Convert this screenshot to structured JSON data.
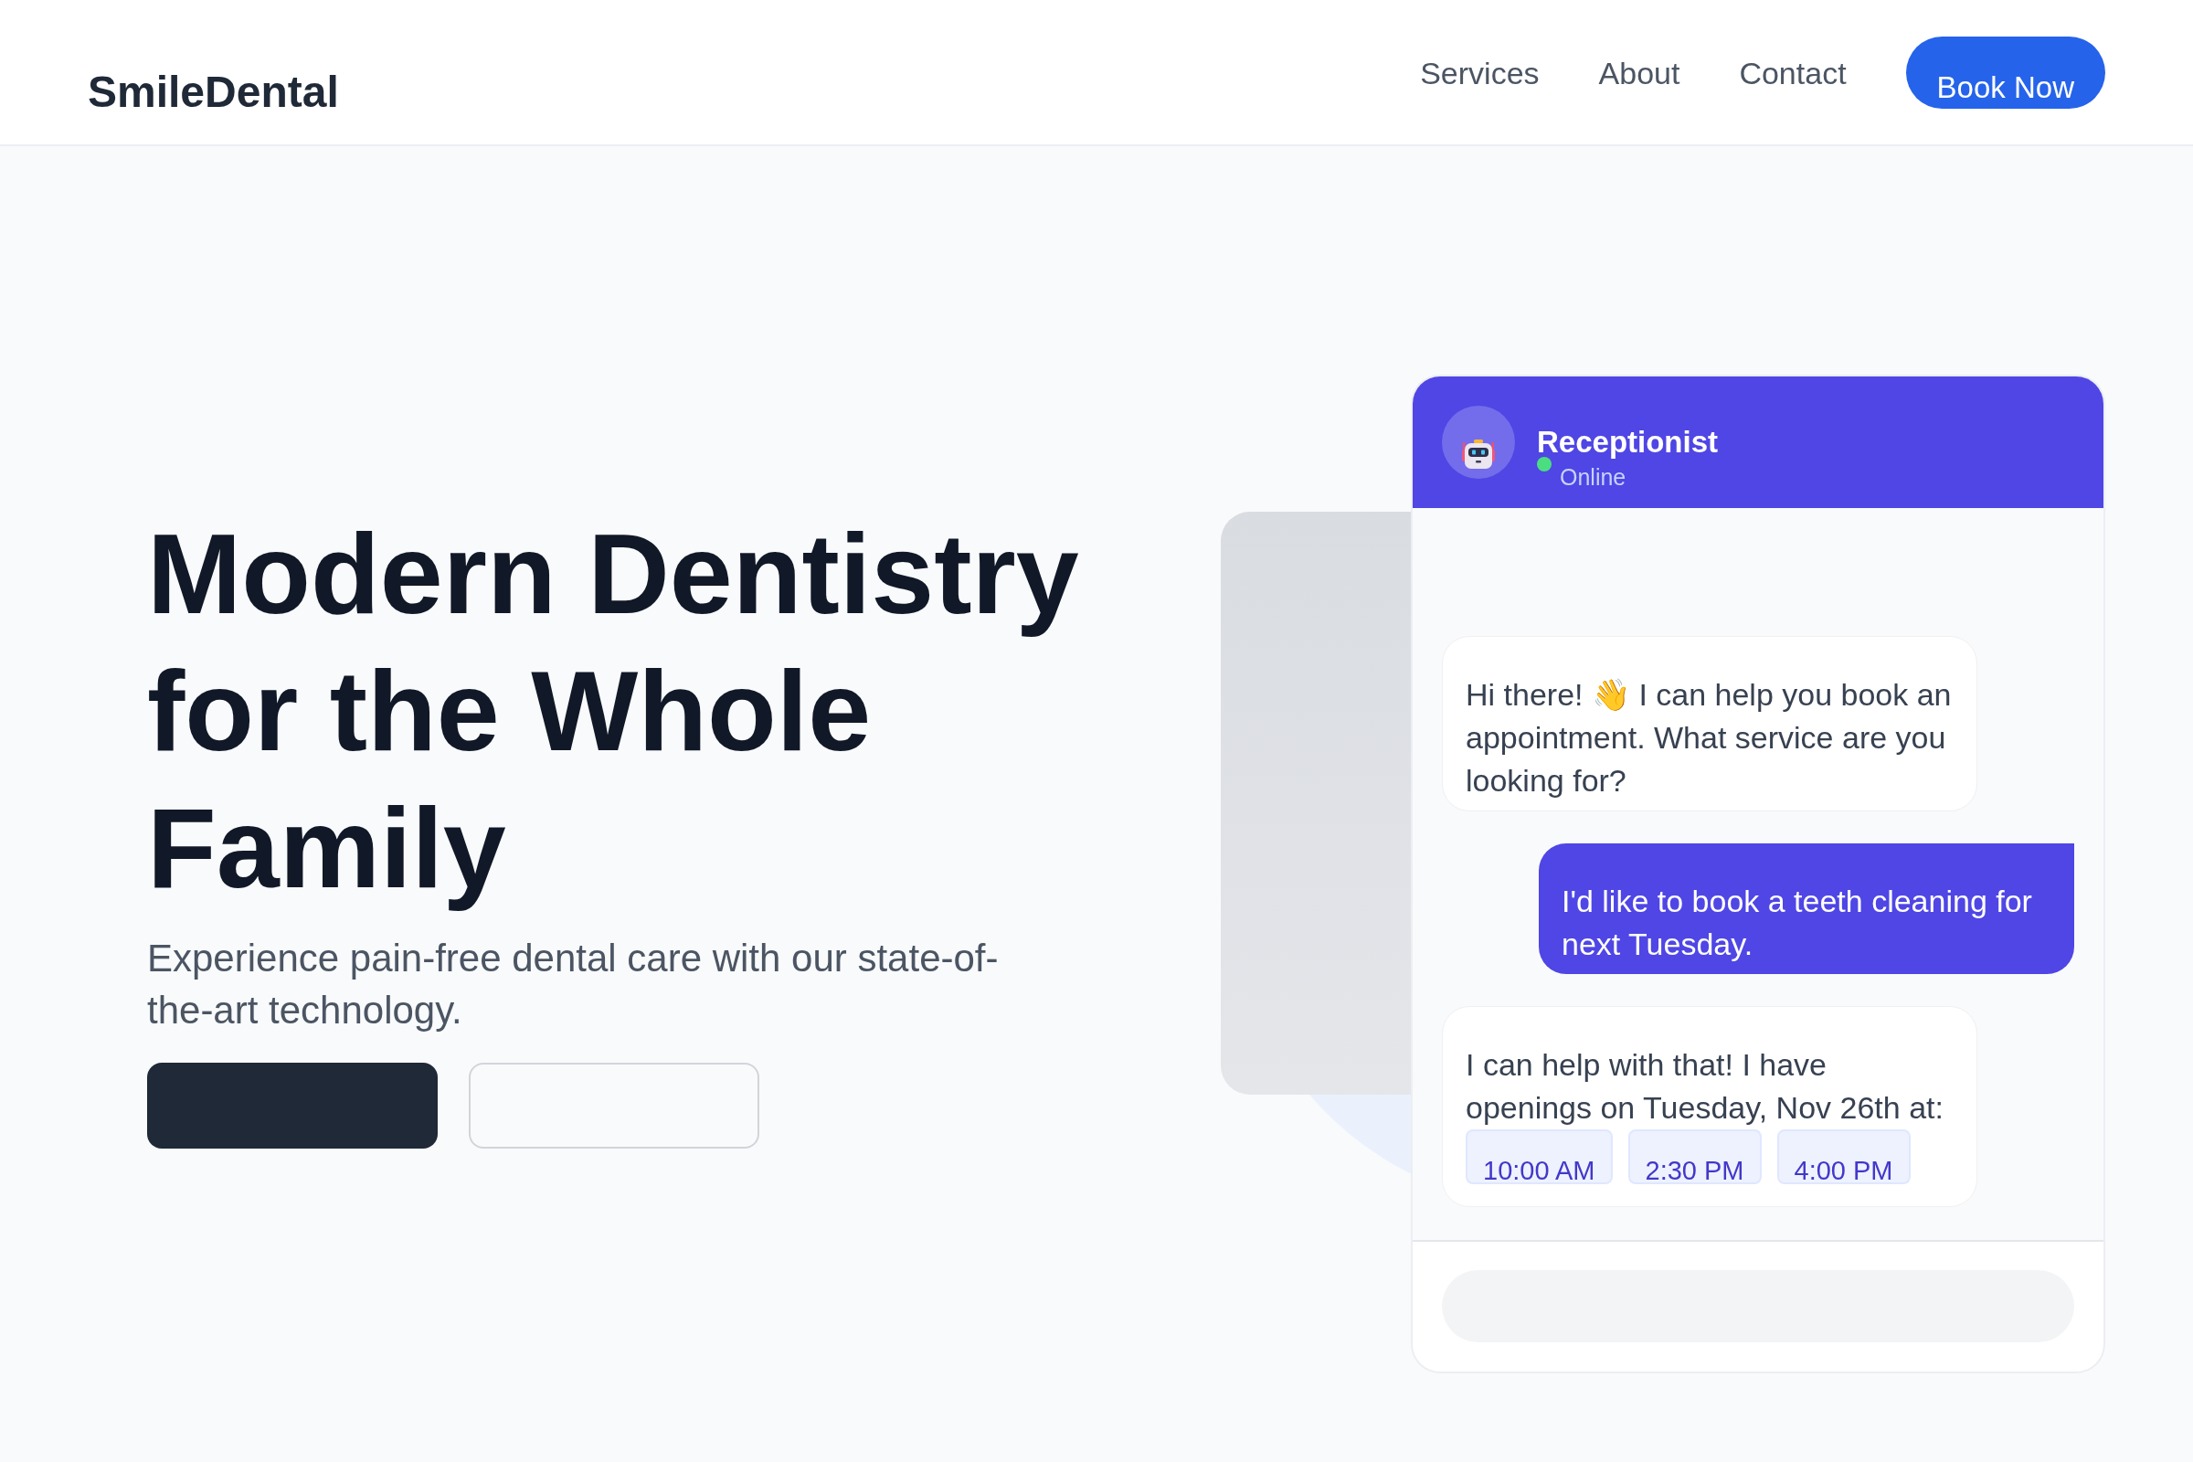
{
  "header": {
    "logo": "SmileDental",
    "nav": [
      "Services",
      "About",
      "Contact"
    ],
    "cta": "Book Now"
  },
  "hero": {
    "title": "Modern Dentistry for the Whole Family",
    "subtitle": "Experience pain-free dental care with our state-of-the-art technology.",
    "buttons": [
      {
        "kind": "filled"
      },
      {
        "kind": "outline"
      }
    ]
  },
  "chat": {
    "name": "Receptionist",
    "status": "Online",
    "online": true,
    "messages": [
      {
        "kind": "bot",
        "text": "Hi there! 👋 I can help you book an appointment. What service are you looking for?"
      },
      {
        "kind": "user",
        "text": "I'd like to book a teeth cleaning for next Tuesday."
      },
      {
        "kind": "bot",
        "text": "I can help with that! I have openings on Tuesday, Nov 26th at:",
        "slots": [
          {
            "label": "10:00 AM",
            "selected": false
          },
          {
            "label": "2:30 PM",
            "selected": false
          },
          {
            "label": "4:00 PM",
            "selected": false
          }
        ]
      }
    ]
  }
}
